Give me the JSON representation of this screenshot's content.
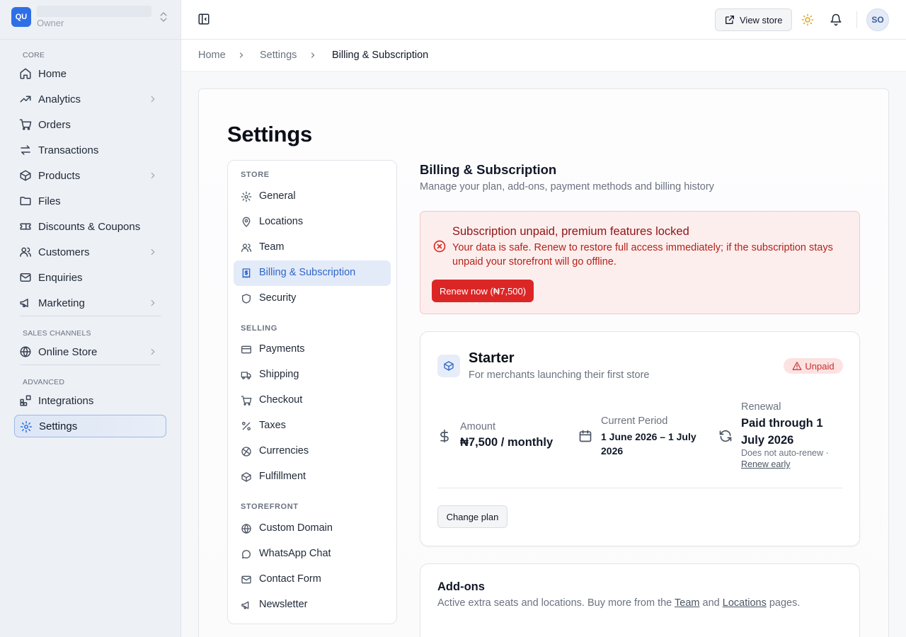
{
  "workspace": {
    "initials": "QU",
    "role": "Owner"
  },
  "sidebar": {
    "groups": [
      "CORE",
      "SALES CHANNELS",
      "ADVANCED"
    ],
    "items": [
      {
        "label": "Home",
        "icon": "home-icon"
      },
      {
        "label": "Analytics",
        "icon": "trending-up-icon"
      },
      {
        "label": "Orders",
        "icon": "cart-icon"
      },
      {
        "label": "Transactions",
        "icon": "arrows-swap-icon"
      },
      {
        "label": "Products",
        "icon": "box-icon"
      },
      {
        "label": "Files",
        "icon": "folder-icon"
      },
      {
        "label": "Discounts & Coupons",
        "icon": "ticket-icon"
      },
      {
        "label": "Customers",
        "icon": "users-icon"
      },
      {
        "label": "Enquiries",
        "icon": "mail-icon"
      },
      {
        "label": "Marketing",
        "icon": "megaphone-icon"
      },
      {
        "label": "Online Store",
        "icon": "globe-icon"
      },
      {
        "label": "Integrations",
        "icon": "blocks-icon"
      },
      {
        "label": "Settings",
        "icon": "gear-icon",
        "active": true
      }
    ]
  },
  "topbar": {
    "view_store": "View store",
    "user_initials": "SO"
  },
  "breadcrumb": [
    "Home",
    "Settings",
    "Billing & Subscription"
  ],
  "page": {
    "title": "Settings"
  },
  "settings_nav": {
    "groups": [
      "STORE",
      "SELLING",
      "STOREFRONT"
    ],
    "items": [
      {
        "label": "General",
        "icon": "gear-icon"
      },
      {
        "label": "Locations",
        "icon": "map-pin-icon"
      },
      {
        "label": "Team",
        "icon": "users-icon"
      },
      {
        "label": "Billing & Subscription",
        "icon": "receipt-icon",
        "active": true
      },
      {
        "label": "Security",
        "icon": "shield-icon"
      },
      {
        "label": "Payments",
        "icon": "credit-card-icon"
      },
      {
        "label": "Shipping",
        "icon": "truck-icon"
      },
      {
        "label": "Checkout",
        "icon": "cart-icon"
      },
      {
        "label": "Taxes",
        "icon": "percent-icon"
      },
      {
        "label": "Currencies",
        "icon": "coins-icon"
      },
      {
        "label": "Fulfillment",
        "icon": "box-icon"
      },
      {
        "label": "Custom Domain",
        "icon": "globe-icon"
      },
      {
        "label": "WhatsApp Chat",
        "icon": "chat-icon"
      },
      {
        "label": "Contact Form",
        "icon": "mail-icon"
      },
      {
        "label": "Newsletter",
        "icon": "megaphone-icon"
      }
    ]
  },
  "billing": {
    "title": "Billing & Subscription",
    "subtitle": "Manage your plan, add-ons, payment methods and billing history",
    "alert": {
      "title": "Subscription unpaid, premium features locked",
      "body": "Your data is safe. Renew to restore full access immediately; if the subscription stays unpaid your storefront will go offline.",
      "button": "Renew now (₦7,500)"
    },
    "plan": {
      "name": "Starter",
      "description": "For merchants launching their first store",
      "status": "Unpaid",
      "amount_label": "Amount",
      "amount_value": "₦7,500 / monthly",
      "period_label": "Current Period",
      "period_value": "1 June 2026 – 1 July 2026",
      "renewal_label": "Renewal",
      "renewal_value": "Paid through 1 July 2026",
      "renewal_note": "Does not auto-renew ·",
      "renew_early": "Renew early",
      "change_plan": "Change plan"
    },
    "addons": {
      "title": "Add-ons",
      "desc_prefix": "Active extra seats and locations. Buy more from the",
      "link_team": "Team",
      "desc_and": "and",
      "link_locations": "Locations",
      "desc_suffix": "pages."
    }
  },
  "colors": {
    "accent": "#2f6fe6",
    "danger": "#dc2626",
    "danger_bg": "#fdeeee",
    "warning_icon": "#e0a325"
  }
}
